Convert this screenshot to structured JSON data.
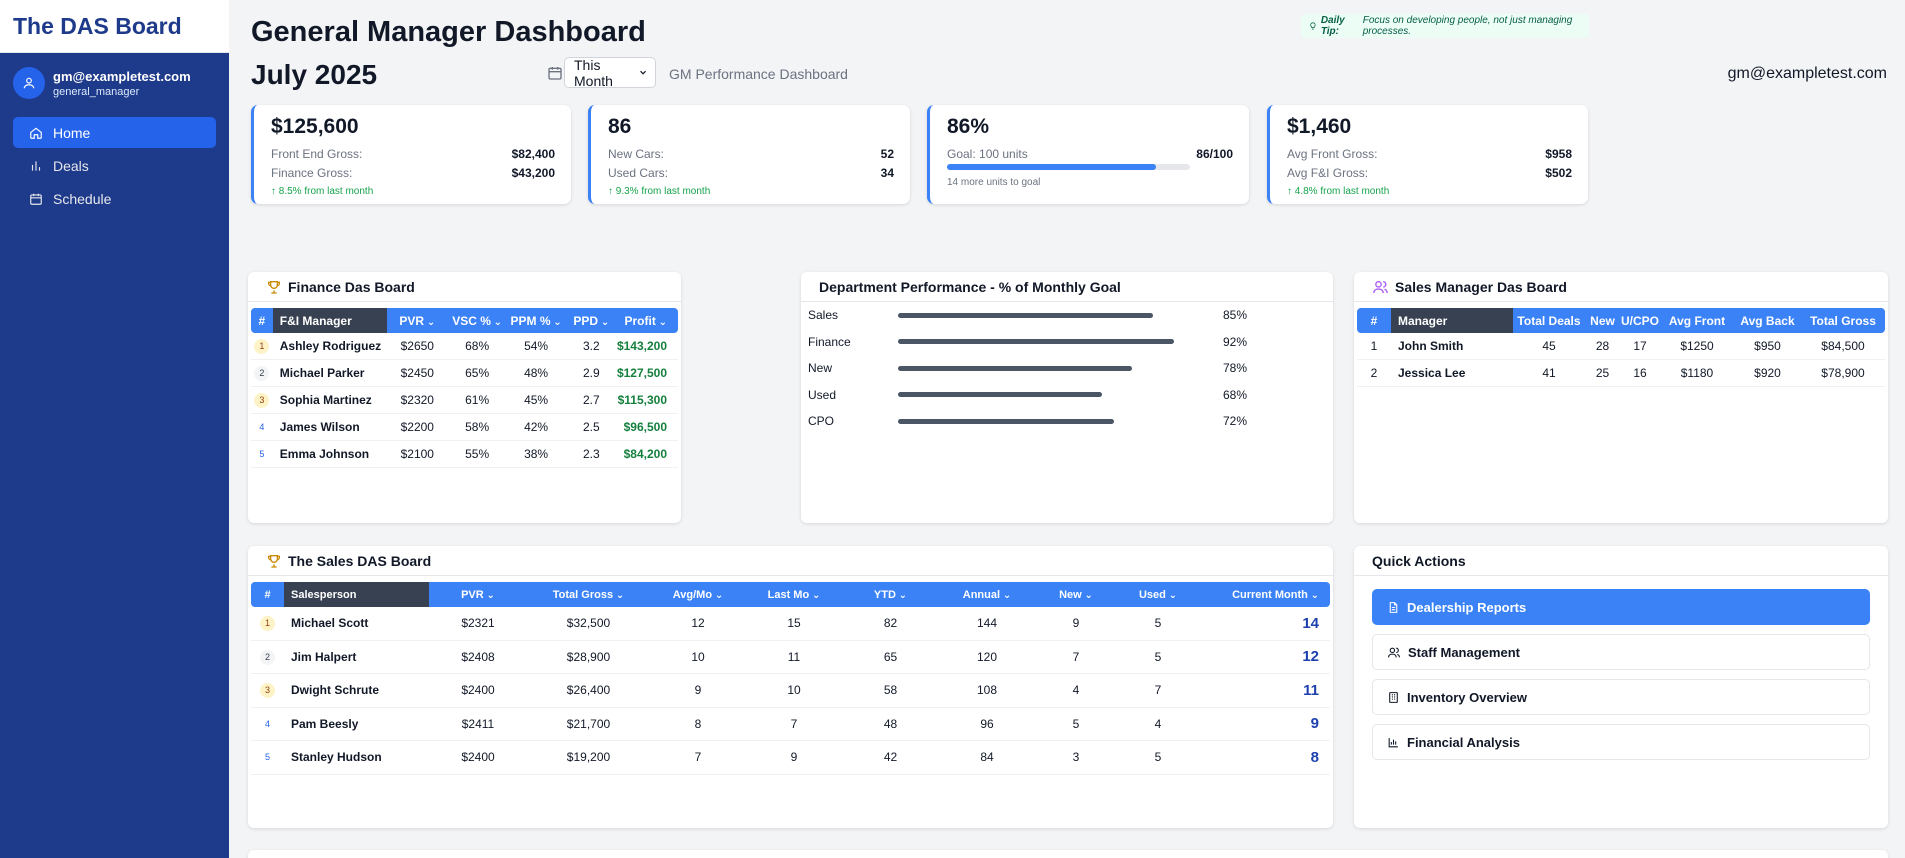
{
  "sidebar": {
    "brand": "The DAS Board",
    "user_email": "gm@exampletest.com",
    "user_role": "general_manager",
    "nav": [
      {
        "label": "Home",
        "icon": "home-icon",
        "active": true
      },
      {
        "label": "Deals",
        "icon": "bar-chart-icon",
        "active": false
      },
      {
        "label": "Schedule",
        "icon": "calendar-icon",
        "active": false
      }
    ]
  },
  "header": {
    "title": "General Manager Dashboard",
    "tip_label": "Daily Tip:",
    "tip_text": "Focus on developing people, not just managing processes.",
    "month": "July 2025",
    "period": "This Month",
    "subtitle": "GM Performance Dashboard",
    "email": "gm@exampletest.com"
  },
  "kpis": {
    "gross": {
      "value": "$125,600",
      "row1_label": "Front End Gross:",
      "row1_value": "$82,400",
      "row2_label": "Finance Gross:",
      "row2_value": "$43,200",
      "trend": "8.5% from last month"
    },
    "units": {
      "value": "86",
      "row1_label": "New Cars:",
      "row1_value": "52",
      "row2_label": "Used Cars:",
      "row2_value": "34",
      "trend": "9.3% from last month"
    },
    "goal": {
      "value": "86%",
      "label": "Goal: 100 units",
      "progress_text": "86/100",
      "progress": 0.86,
      "note": "14 more units to goal"
    },
    "avg": {
      "value": "$1,460",
      "row1_label": "Avg Front Gross:",
      "row1_value": "$958",
      "row2_label": "Avg F&I Gross:",
      "row2_value": "$502",
      "trend": "4.8% from last month"
    }
  },
  "finance": {
    "title": "Finance Das Board",
    "headers": [
      "#",
      "F&I Manager",
      "PVR",
      "VSC %",
      "PPM %",
      "PPD",
      "Profit"
    ],
    "rows": [
      {
        "rank": "1",
        "name": "Ashley Rodriguez",
        "pvr": "$2650",
        "vsc": "68%",
        "ppm": "54%",
        "ppd": "3.2",
        "profit": "$143,200"
      },
      {
        "rank": "2",
        "name": "Michael Parker",
        "pvr": "$2450",
        "vsc": "65%",
        "ppm": "48%",
        "ppd": "2.9",
        "profit": "$127,500"
      },
      {
        "rank": "3",
        "name": "Sophia Martinez",
        "pvr": "$2320",
        "vsc": "61%",
        "ppm": "45%",
        "ppd": "2.7",
        "profit": "$115,300"
      },
      {
        "rank": "4",
        "name": "James Wilson",
        "pvr": "$2200",
        "vsc": "58%",
        "ppm": "42%",
        "ppd": "2.5",
        "profit": "$96,500"
      },
      {
        "rank": "5",
        "name": "Emma Johnson",
        "pvr": "$2100",
        "vsc": "55%",
        "ppm": "38%",
        "ppd": "2.3",
        "profit": "$84,200"
      }
    ]
  },
  "department": {
    "title": "Department Performance - % of Monthly Goal",
    "rows": [
      {
        "label": "Sales",
        "pct_text": "85%",
        "pct": 0.85
      },
      {
        "label": "Finance",
        "pct_text": "92%",
        "pct": 0.92
      },
      {
        "label": "New",
        "pct_text": "78%",
        "pct": 0.78
      },
      {
        "label": "Used",
        "pct_text": "68%",
        "pct": 0.68
      },
      {
        "label": "CPO",
        "pct_text": "72%",
        "pct": 0.72
      }
    ]
  },
  "sales_manager": {
    "title": "Sales Manager Das Board",
    "headers": [
      "#",
      "Manager",
      "Total Deals",
      "New",
      "U/CPO",
      "Avg Front",
      "Avg Back",
      "Total Gross"
    ],
    "rows": [
      {
        "rank": "1",
        "name": "John Smith",
        "deals": "45",
        "new": "28",
        "ucpo": "17",
        "front": "$1250",
        "back": "$950",
        "gross": "$84,500"
      },
      {
        "rank": "2",
        "name": "Jessica Lee",
        "deals": "41",
        "new": "25",
        "ucpo": "16",
        "front": "$1180",
        "back": "$920",
        "gross": "$78,900"
      }
    ]
  },
  "sales": {
    "title": "The Sales DAS Board",
    "headers": [
      "#",
      "Salesperson",
      "PVR",
      "Total Gross",
      "Avg/Mo",
      "Last Mo",
      "YTD",
      "Annual",
      "New",
      "Used",
      "Current Month"
    ],
    "rows": [
      {
        "rank": "1",
        "name": "Michael Scott",
        "pvr": "$2321",
        "gross": "$32,500",
        "avg": "12",
        "last": "15",
        "ytd": "82",
        "annual": "144",
        "new": "9",
        "used": "5",
        "current": "14"
      },
      {
        "rank": "2",
        "name": "Jim Halpert",
        "pvr": "$2408",
        "gross": "$28,900",
        "avg": "10",
        "last": "11",
        "ytd": "65",
        "annual": "120",
        "new": "7",
        "used": "5",
        "current": "12"
      },
      {
        "rank": "3",
        "name": "Dwight Schrute",
        "pvr": "$2400",
        "gross": "$26,400",
        "avg": "9",
        "last": "10",
        "ytd": "58",
        "annual": "108",
        "new": "4",
        "used": "7",
        "current": "11"
      },
      {
        "rank": "4",
        "name": "Pam Beesly",
        "pvr": "$2411",
        "gross": "$21,700",
        "avg": "8",
        "last": "7",
        "ytd": "48",
        "annual": "96",
        "new": "5",
        "used": "4",
        "current": "9"
      },
      {
        "rank": "5",
        "name": "Stanley Hudson",
        "pvr": "$2400",
        "gross": "$19,200",
        "avg": "7",
        "last": "9",
        "ytd": "42",
        "annual": "84",
        "new": "3",
        "used": "5",
        "current": "8"
      }
    ]
  },
  "quick_actions": {
    "title": "Quick Actions",
    "items": [
      {
        "label": "Dealership Reports",
        "icon": "document-icon"
      },
      {
        "label": "Staff Management",
        "icon": "users-icon"
      },
      {
        "label": "Inventory Overview",
        "icon": "building-icon"
      },
      {
        "label": "Financial Analysis",
        "icon": "bar-chart-icon"
      }
    ]
  },
  "colors": {
    "sidebar": "#1e3a8a",
    "accent": "#3b82f6",
    "positive": "#16a34a"
  }
}
